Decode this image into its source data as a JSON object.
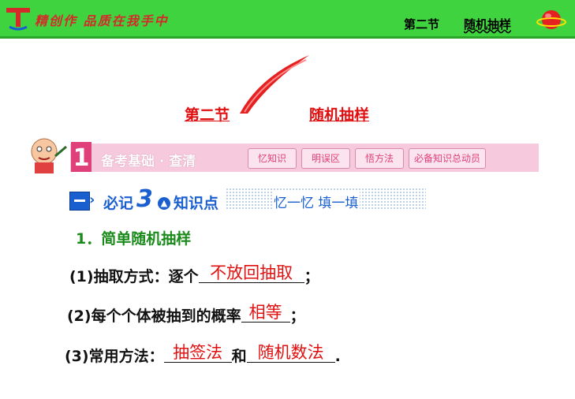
{
  "header": {
    "slogan": "精创作 品质在我手中",
    "section": "第二节",
    "subsection": "随机抽样"
  },
  "title": {
    "part1": "第二节",
    "part2": "随机抽样"
  },
  "section_bar": {
    "number": "1",
    "title": "备考基础 · 查清",
    "tabs": [
      "忆知识",
      "明误区",
      "悟方法",
      "必备知识总动员"
    ]
  },
  "subsection": {
    "prefix": "必记",
    "number": "3",
    "label": "知识点",
    "tagline": "忆一忆  填一填"
  },
  "content": {
    "heading": "1．简单随机抽样",
    "item1": {
      "prefix": "(1)抽取方式：逐个",
      "answer": "不放回抽取",
      "suffix": "；"
    },
    "item2": {
      "prefix": "(2)每个个体被抽到的概率",
      "answer": "相等",
      "suffix": "；"
    },
    "item3": {
      "prefix": "(3)常用方法：",
      "answer1": "抽签法",
      "middle": "和",
      "answer2": "随机数法",
      "suffix": "."
    }
  },
  "colors": {
    "topbar": "#3fd43f",
    "accent_red": "#e01010",
    "accent_blue": "#1a5fd0",
    "section_pink": "#f6c9dd"
  }
}
